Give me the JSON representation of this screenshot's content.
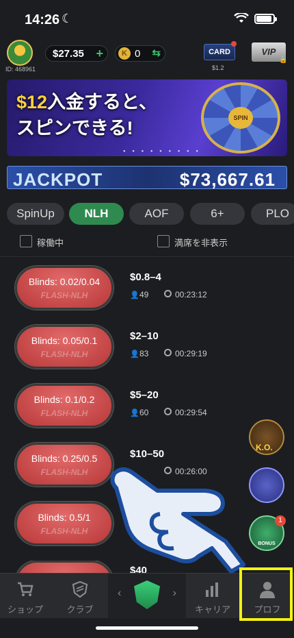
{
  "status_bar": {
    "time": "14:26"
  },
  "header": {
    "user_id": "ID: 468961",
    "balance": "$27.35",
    "coins": "0",
    "card_label": "CARD",
    "card_price": "$1.2",
    "vip_label": "VIP"
  },
  "banner": {
    "amount": "$12",
    "line1": "入金すると、",
    "line2": "スピンできる!",
    "wheel_center": "SPIN"
  },
  "jackpot": {
    "label": "JACKPOT",
    "value": "$73,667.61"
  },
  "tabs": [
    {
      "label": "SpinUp"
    },
    {
      "label": "NLH",
      "active": true
    },
    {
      "label": "AOF"
    },
    {
      "label": "6+"
    },
    {
      "label": "PLO"
    }
  ],
  "filters": {
    "running": "稼働中",
    "hide_full": "満席を非表示"
  },
  "tables": [
    {
      "blinds": "Blinds: 0.02/0.04",
      "type": "FLASH-NLH",
      "stakes": "$0.8–4",
      "players": "49",
      "timer": "00:23:12"
    },
    {
      "blinds": "Blinds: 0.05/0.1",
      "type": "FLASH-NLH",
      "stakes": "$2–10",
      "players": "83",
      "timer": "00:29:19"
    },
    {
      "blinds": "Blinds: 0.1/0.2",
      "type": "FLASH-NLH",
      "stakes": "$5–20",
      "players": "60",
      "timer": "00:29:54"
    },
    {
      "blinds": "Blinds: 0.25/0.5",
      "type": "FLASH-NLH",
      "stakes": "$10–50",
      "players": "",
      "timer": "00:26:00"
    },
    {
      "blinds": "Blinds: 0.5/1",
      "type": "FLASH-NLH",
      "stakes": "",
      "players": "",
      "timer": ""
    },
    {
      "blinds": "",
      "type": "",
      "stakes": "$40",
      "players": "",
      "timer": ""
    }
  ],
  "side": {
    "ko_label": "K.O.",
    "bonus_label": "BONUS",
    "bonus_badge": "1"
  },
  "nav": {
    "shop": "ショップ",
    "club": "クラブ",
    "career": "キャリア",
    "profile": "プロフ"
  },
  "colors": {
    "accent_green": "#2f8a50",
    "pill_red": "#d04a4a",
    "highlight": "#f3f313"
  }
}
